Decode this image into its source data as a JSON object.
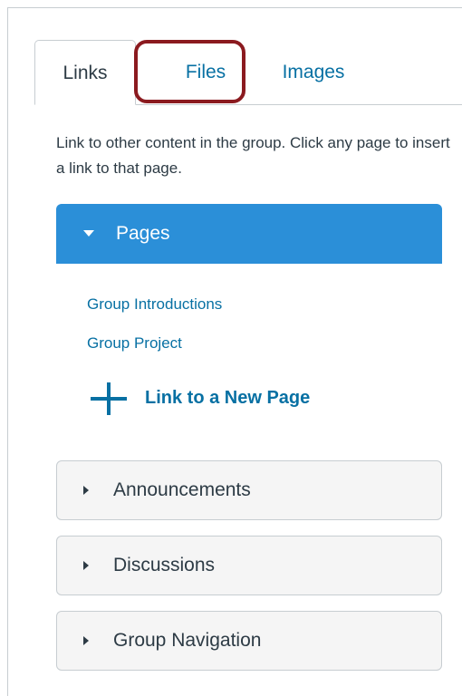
{
  "tabs": [
    {
      "label": "Links",
      "active": true
    },
    {
      "label": "Files",
      "active": false
    },
    {
      "label": "Images",
      "active": false
    }
  ],
  "instructions": "Link to other content in the group. Click any page to insert a link to that page.",
  "pages_section": {
    "title": "Pages",
    "expanded": true,
    "items": [
      "Group Introductions",
      "Group Project"
    ],
    "new_page_label": "Link to a New Page",
    "new_page_icon": "plus-icon"
  },
  "accordions": [
    {
      "label": "Announcements",
      "expanded": false
    },
    {
      "label": "Discussions",
      "expanded": false
    },
    {
      "label": "Group Navigation",
      "expanded": false
    }
  ],
  "colors": {
    "accent": "#2b8fd8",
    "link": "#0770a3",
    "highlight": "#8b1a1f",
    "text": "#2d3b45"
  }
}
